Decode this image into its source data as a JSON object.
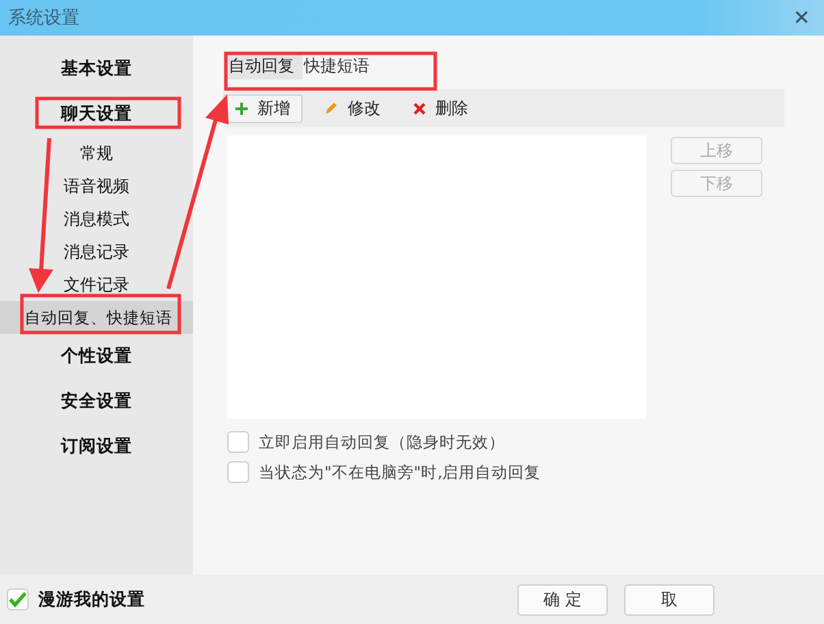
{
  "window": {
    "title": "系统设置",
    "close": "✕"
  },
  "sidebar": {
    "items": [
      {
        "label": "基本设置",
        "selected": false
      },
      {
        "label": "聊天设置",
        "selected": false,
        "children": [
          {
            "label": "常规",
            "selected": false
          },
          {
            "label": "语音视频",
            "selected": false
          },
          {
            "label": "消息模式",
            "selected": false
          },
          {
            "label": "消息记录",
            "selected": false
          },
          {
            "label": "文件记录",
            "selected": false
          },
          {
            "label": "自动回复、快捷短语",
            "selected": true
          }
        ]
      },
      {
        "label": "个性设置",
        "selected": false
      },
      {
        "label": "安全设置",
        "selected": false
      },
      {
        "label": "订阅设置",
        "selected": false
      }
    ]
  },
  "tabs": [
    {
      "label": "自动回复",
      "selected": true
    },
    {
      "label": "快捷短语",
      "selected": false
    }
  ],
  "toolbar": [
    {
      "kind": "add",
      "label": "新增"
    },
    {
      "kind": "edit",
      "label": "修改"
    },
    {
      "kind": "delete",
      "label": "删除"
    }
  ],
  "move_buttons": [
    {
      "label": "上移",
      "disabled": true
    },
    {
      "label": "下移",
      "disabled": true
    }
  ],
  "options": [
    {
      "label": "立即启用自动回复（隐身时无效）",
      "checked": false
    },
    {
      "label": "当状态为\"不在电脑旁\"时,启用自动回复",
      "checked": false
    }
  ],
  "roam": {
    "label": "漫游我的设置",
    "checked": true
  },
  "buttons": [
    {
      "label": "确 定"
    },
    {
      "label": "取"
    }
  ]
}
